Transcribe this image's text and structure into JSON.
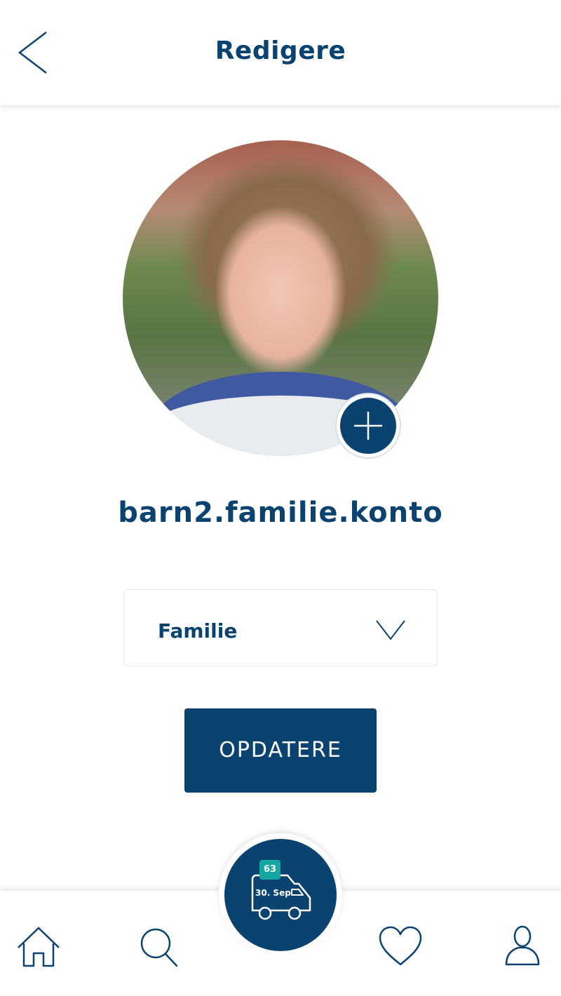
{
  "header": {
    "title": "Redigere"
  },
  "profile": {
    "username": "barn2.familie.konto"
  },
  "role_select": {
    "selected": "Familie"
  },
  "actions": {
    "update_label": "OPDATERE"
  },
  "delivery": {
    "count": "63",
    "date": "30. Sep"
  },
  "icons": {
    "back": "chevron-left-icon",
    "add_photo": "plus-icon",
    "dropdown": "chevron-down-icon",
    "home": "home-icon",
    "search": "search-icon",
    "truck": "delivery-truck-icon",
    "favorites": "heart-icon",
    "profile": "user-icon"
  },
  "colors": {
    "primary": "#0b4370",
    "badge": "#12a7a2",
    "background": "#ffffff"
  }
}
